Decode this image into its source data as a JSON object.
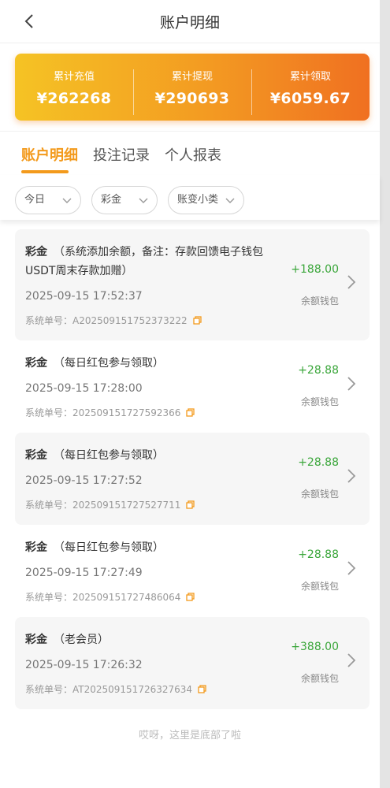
{
  "header": {
    "title": "账户明细",
    "back_icon": "chevron-left-icon"
  },
  "summary": {
    "stats": [
      {
        "label": "累计充值",
        "value": "¥262268"
      },
      {
        "label": "累计提现",
        "value": "¥290693"
      },
      {
        "label": "累计领取",
        "value": "¥6059.67"
      }
    ],
    "gradient_colors": [
      "#f5c324",
      "#f07021"
    ]
  },
  "tabs": [
    {
      "label": "账户明细",
      "active": true
    },
    {
      "label": "投注记录",
      "active": false
    },
    {
      "label": "个人报表",
      "active": false
    }
  ],
  "filters": [
    {
      "value": "今日"
    },
    {
      "value": "彩金"
    },
    {
      "value": "账变小类"
    }
  ],
  "records": [
    {
      "kind": "彩金",
      "desc": "（系统添加余额，备注：存款回馈电子钱包USDT周末存款加赠）",
      "time": "2025-09-15 17:52:37",
      "order": "系统单号：A202509151752373222",
      "amount": "+188.00",
      "wallet": "余额钱包"
    },
    {
      "kind": "彩金",
      "desc": "（每日红包参与领取）",
      "time": "2025-09-15 17:28:00",
      "order": "系统单号：202509151727592366",
      "amount": "+28.88",
      "wallet": "余额钱包"
    },
    {
      "kind": "彩金",
      "desc": "（每日红包参与领取）",
      "time": "2025-09-15 17:27:52",
      "order": "系统单号：202509151727527711",
      "amount": "+28.88",
      "wallet": "余额钱包"
    },
    {
      "kind": "彩金",
      "desc": "（每日红包参与领取）",
      "time": "2025-09-15 17:27:49",
      "order": "系统单号：202509151727486064",
      "amount": "+28.88",
      "wallet": "余额钱包"
    },
    {
      "kind": "彩金",
      "desc": "（老会员）",
      "time": "2025-09-15 17:26:32",
      "order": "系统单号：AT202509151726327634",
      "amount": "+388.00",
      "wallet": "余额钱包"
    }
  ],
  "end_note": "哎呀，这里是底部了啦",
  "colors": {
    "accent": "#f39a1c",
    "positive": "#3aa63a"
  }
}
